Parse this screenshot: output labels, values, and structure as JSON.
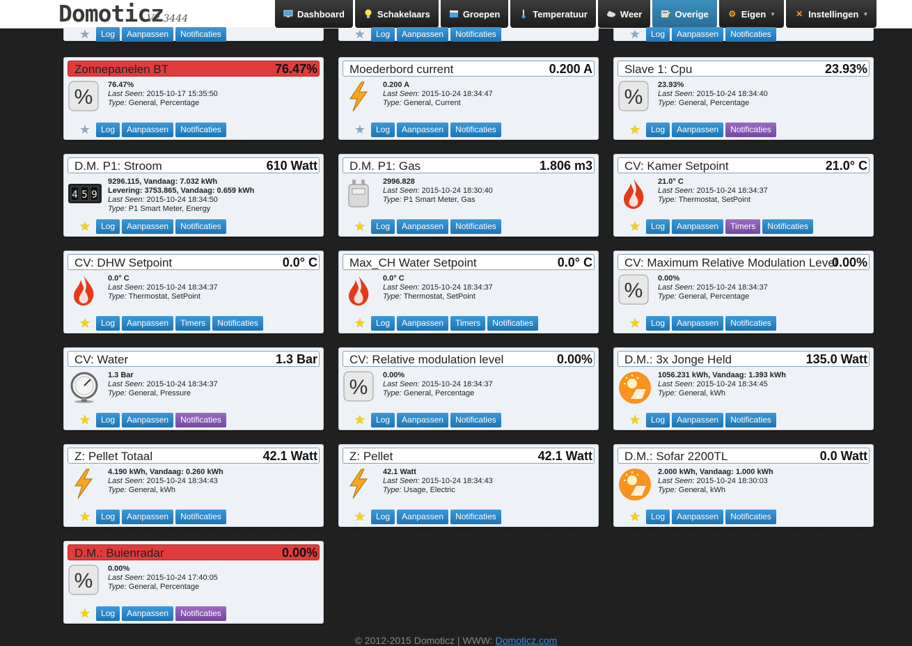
{
  "brand": {
    "name": "Domoticz",
    "version": "V2.3444"
  },
  "nav": [
    {
      "label": "Dashboard",
      "icon": "monitor-icon"
    },
    {
      "label": "Schakelaars",
      "icon": "lightbulb-icon"
    },
    {
      "label": "Groepen",
      "icon": "clapper-icon"
    },
    {
      "label": "Temperatuur",
      "icon": "thermometer-icon"
    },
    {
      "label": "Weer",
      "icon": "cloud-icon"
    },
    {
      "label": "Overige",
      "icon": "utility-icon"
    },
    {
      "label": "Eigen",
      "icon": "gear-icon"
    },
    {
      "label": "Instellingen",
      "icon": "tools-icon"
    }
  ],
  "button_labels": {
    "log": "Log",
    "edit": "Aanpassen",
    "timers": "Timers",
    "notifications": "Notificaties"
  },
  "labels": {
    "last_seen": "Last Seen:",
    "type": "Type:"
  },
  "cards": [
    {
      "name": "Zonnepanelen BT",
      "value": "76.47%",
      "line1": "76.47%",
      "last_seen": "2015-10-17 15:35:50",
      "type": "General, Percentage"
    },
    {
      "name": "Moederbord current",
      "value": "0.200 A",
      "line1": "0.200 A",
      "last_seen": "2015-10-24 18:34:47",
      "type": "General, Current"
    },
    {
      "name": "Slave 1: Cpu",
      "value": "23.93%",
      "line1": "23.93%",
      "last_seen": "2015-10-24 18:34:40",
      "type": "General, Percentage"
    },
    {
      "name": "D.M. P1: Stroom",
      "value": "610 Watt",
      "line1": "9296.115, Vandaag: 7.032 kWh",
      "line2": "Levering: 3753.865, Vandaag: 0.659 kWh",
      "last_seen": "2015-10-24 18:34:50",
      "type": "P1 Smart Meter, Energy",
      "counter_digits": "45"
    },
    {
      "name": "D.M. P1: Gas",
      "value": "1.806 m3",
      "line1": "2996.828",
      "last_seen": "2015-10-24 18:30:40",
      "type": "P1 Smart Meter, Gas"
    },
    {
      "name": "CV: Kamer Setpoint",
      "value": "21.0° C",
      "line1": "21.0° C",
      "last_seen": "2015-10-24 18:34:37",
      "type": "Thermostat, SetPoint"
    },
    {
      "name": "CV: DHW Setpoint",
      "value": "0.0° C",
      "line1": "0.0° C",
      "last_seen": "2015-10-24 18:34:37",
      "type": "Thermostat, SetPoint"
    },
    {
      "name": "Max_CH Water Setpoint",
      "value": "0.0° C",
      "line1": "0.0° C",
      "last_seen": "2015-10-24 18:34:37",
      "type": "Thermostat, SetPoint"
    },
    {
      "name": "CV: Maximum Relative Modulation Level",
      "value": "0.00%",
      "line1": "0.00%",
      "last_seen": "2015-10-24 18:34:37",
      "type": "General, Percentage"
    },
    {
      "name": "CV: Water",
      "value": "1.3 Bar",
      "line1": "1.3 Bar",
      "last_seen": "2015-10-24 18:34:37",
      "type": "General, Pressure"
    },
    {
      "name": "CV: Relative modulation level",
      "value": "0.00%",
      "line1": "0.00%",
      "last_seen": "2015-10-24 18:34:37",
      "type": "General, Percentage"
    },
    {
      "name": "D.M.: 3x Jonge Held",
      "value": "135.0 Watt",
      "line1": "1056.231 kWh, Vandaag: 1.393 kWh",
      "last_seen": "2015-10-24 18:34:45",
      "type": "General, kWh"
    },
    {
      "name": "Z: Pellet Totaal",
      "value": "42.1 Watt",
      "line1": "4.190 kWh, Vandaag: 0.260 kWh",
      "last_seen": "2015-10-24 18:34:43",
      "type": "General, kWh"
    },
    {
      "name": "Z: Pellet",
      "value": "42.1 Watt",
      "line1": "42.1 Watt",
      "last_seen": "2015-10-24 18:34:43",
      "type": "Usage, Electric"
    },
    {
      "name": "D.M.: Sofar 2200TL",
      "value": "0.0 Watt",
      "line1": "2.000 kWh, Vandaag: 1.000 kWh",
      "last_seen": "2015-10-24 18:30:03",
      "type": "General, kWh"
    },
    {
      "name": "D.M.: Buienradar",
      "value": "0.00%",
      "line1": "0.00%",
      "last_seen": "2015-10-24 17:40:05",
      "type": "General, Percentage"
    }
  ],
  "colors": {
    "alert_header": "#e03c3c",
    "button_blue": "#2a82c4",
    "button_purple": "#8657b3",
    "active_nav": "#337fb0"
  },
  "footer": {
    "text": "© 2012-2015 Domoticz | WWW:",
    "link": "Domoticz.com"
  }
}
